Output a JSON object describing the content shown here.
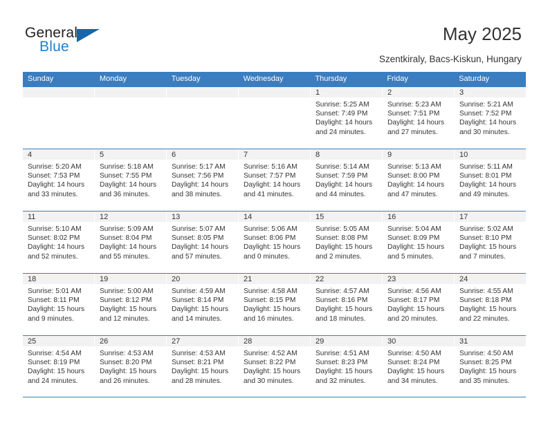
{
  "brand": {
    "name_part1": "General",
    "name_part2": "Blue",
    "triangle_icon": "brand-triangle-icon",
    "accent_color": "#1c7fd0"
  },
  "header": {
    "title": "May 2025",
    "subtitle": "Szentkiraly, Bacs-Kiskun, Hungary"
  },
  "colors": {
    "header_blue": "#3a7dc0",
    "day_number_band": "#f2f2f2",
    "text": "#333333"
  },
  "weekdays": [
    "Sunday",
    "Monday",
    "Tuesday",
    "Wednesday",
    "Thursday",
    "Friday",
    "Saturday"
  ],
  "weeks": [
    [
      {
        "day": "",
        "empty": true
      },
      {
        "day": "",
        "empty": true
      },
      {
        "day": "",
        "empty": true
      },
      {
        "day": "",
        "empty": true
      },
      {
        "day": "1",
        "sunrise": "Sunrise: 5:25 AM",
        "sunset": "Sunset: 7:49 PM",
        "daylight": "Daylight: 14 hours and 24 minutes."
      },
      {
        "day": "2",
        "sunrise": "Sunrise: 5:23 AM",
        "sunset": "Sunset: 7:51 PM",
        "daylight": "Daylight: 14 hours and 27 minutes."
      },
      {
        "day": "3",
        "sunrise": "Sunrise: 5:21 AM",
        "sunset": "Sunset: 7:52 PM",
        "daylight": "Daylight: 14 hours and 30 minutes."
      }
    ],
    [
      {
        "day": "4",
        "sunrise": "Sunrise: 5:20 AM",
        "sunset": "Sunset: 7:53 PM",
        "daylight": "Daylight: 14 hours and 33 minutes."
      },
      {
        "day": "5",
        "sunrise": "Sunrise: 5:18 AM",
        "sunset": "Sunset: 7:55 PM",
        "daylight": "Daylight: 14 hours and 36 minutes."
      },
      {
        "day": "6",
        "sunrise": "Sunrise: 5:17 AM",
        "sunset": "Sunset: 7:56 PM",
        "daylight": "Daylight: 14 hours and 38 minutes."
      },
      {
        "day": "7",
        "sunrise": "Sunrise: 5:16 AM",
        "sunset": "Sunset: 7:57 PM",
        "daylight": "Daylight: 14 hours and 41 minutes."
      },
      {
        "day": "8",
        "sunrise": "Sunrise: 5:14 AM",
        "sunset": "Sunset: 7:59 PM",
        "daylight": "Daylight: 14 hours and 44 minutes."
      },
      {
        "day": "9",
        "sunrise": "Sunrise: 5:13 AM",
        "sunset": "Sunset: 8:00 PM",
        "daylight": "Daylight: 14 hours and 47 minutes."
      },
      {
        "day": "10",
        "sunrise": "Sunrise: 5:11 AM",
        "sunset": "Sunset: 8:01 PM",
        "daylight": "Daylight: 14 hours and 49 minutes."
      }
    ],
    [
      {
        "day": "11",
        "sunrise": "Sunrise: 5:10 AM",
        "sunset": "Sunset: 8:02 PM",
        "daylight": "Daylight: 14 hours and 52 minutes."
      },
      {
        "day": "12",
        "sunrise": "Sunrise: 5:09 AM",
        "sunset": "Sunset: 8:04 PM",
        "daylight": "Daylight: 14 hours and 55 minutes."
      },
      {
        "day": "13",
        "sunrise": "Sunrise: 5:07 AM",
        "sunset": "Sunset: 8:05 PM",
        "daylight": "Daylight: 14 hours and 57 minutes."
      },
      {
        "day": "14",
        "sunrise": "Sunrise: 5:06 AM",
        "sunset": "Sunset: 8:06 PM",
        "daylight": "Daylight: 15 hours and 0 minutes."
      },
      {
        "day": "15",
        "sunrise": "Sunrise: 5:05 AM",
        "sunset": "Sunset: 8:08 PM",
        "daylight": "Daylight: 15 hours and 2 minutes."
      },
      {
        "day": "16",
        "sunrise": "Sunrise: 5:04 AM",
        "sunset": "Sunset: 8:09 PM",
        "daylight": "Daylight: 15 hours and 5 minutes."
      },
      {
        "day": "17",
        "sunrise": "Sunrise: 5:02 AM",
        "sunset": "Sunset: 8:10 PM",
        "daylight": "Daylight: 15 hours and 7 minutes."
      }
    ],
    [
      {
        "day": "18",
        "sunrise": "Sunrise: 5:01 AM",
        "sunset": "Sunset: 8:11 PM",
        "daylight": "Daylight: 15 hours and 9 minutes."
      },
      {
        "day": "19",
        "sunrise": "Sunrise: 5:00 AM",
        "sunset": "Sunset: 8:12 PM",
        "daylight": "Daylight: 15 hours and 12 minutes."
      },
      {
        "day": "20",
        "sunrise": "Sunrise: 4:59 AM",
        "sunset": "Sunset: 8:14 PM",
        "daylight": "Daylight: 15 hours and 14 minutes."
      },
      {
        "day": "21",
        "sunrise": "Sunrise: 4:58 AM",
        "sunset": "Sunset: 8:15 PM",
        "daylight": "Daylight: 15 hours and 16 minutes."
      },
      {
        "day": "22",
        "sunrise": "Sunrise: 4:57 AM",
        "sunset": "Sunset: 8:16 PM",
        "daylight": "Daylight: 15 hours and 18 minutes."
      },
      {
        "day": "23",
        "sunrise": "Sunrise: 4:56 AM",
        "sunset": "Sunset: 8:17 PM",
        "daylight": "Daylight: 15 hours and 20 minutes."
      },
      {
        "day": "24",
        "sunrise": "Sunrise: 4:55 AM",
        "sunset": "Sunset: 8:18 PM",
        "daylight": "Daylight: 15 hours and 22 minutes."
      }
    ],
    [
      {
        "day": "25",
        "sunrise": "Sunrise: 4:54 AM",
        "sunset": "Sunset: 8:19 PM",
        "daylight": "Daylight: 15 hours and 24 minutes."
      },
      {
        "day": "26",
        "sunrise": "Sunrise: 4:53 AM",
        "sunset": "Sunset: 8:20 PM",
        "daylight": "Daylight: 15 hours and 26 minutes."
      },
      {
        "day": "27",
        "sunrise": "Sunrise: 4:53 AM",
        "sunset": "Sunset: 8:21 PM",
        "daylight": "Daylight: 15 hours and 28 minutes."
      },
      {
        "day": "28",
        "sunrise": "Sunrise: 4:52 AM",
        "sunset": "Sunset: 8:22 PM",
        "daylight": "Daylight: 15 hours and 30 minutes."
      },
      {
        "day": "29",
        "sunrise": "Sunrise: 4:51 AM",
        "sunset": "Sunset: 8:23 PM",
        "daylight": "Daylight: 15 hours and 32 minutes."
      },
      {
        "day": "30",
        "sunrise": "Sunrise: 4:50 AM",
        "sunset": "Sunset: 8:24 PM",
        "daylight": "Daylight: 15 hours and 34 minutes."
      },
      {
        "day": "31",
        "sunrise": "Sunrise: 4:50 AM",
        "sunset": "Sunset: 8:25 PM",
        "daylight": "Daylight: 15 hours and 35 minutes."
      }
    ]
  ]
}
